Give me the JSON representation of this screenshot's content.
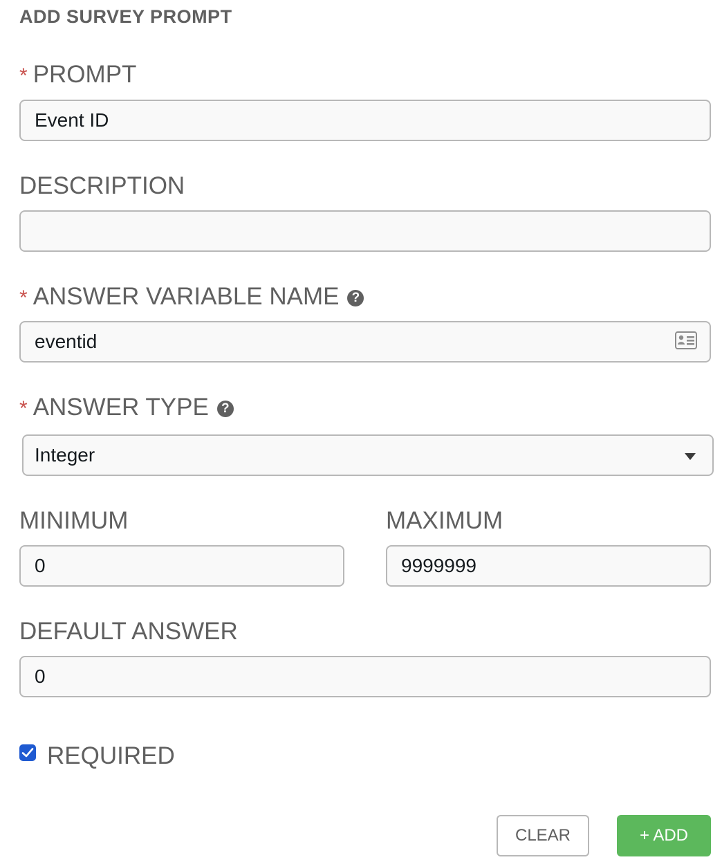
{
  "form": {
    "title": "ADD SURVEY PROMPT"
  },
  "fields": {
    "prompt": {
      "required_mark": "*",
      "label": "PROMPT",
      "value": "Event ID"
    },
    "description": {
      "label": "DESCRIPTION",
      "value": ""
    },
    "answer_variable_name": {
      "required_mark": "*",
      "label": "ANSWER VARIABLE NAME",
      "value": "eventid",
      "help_icon": "question-circle-icon",
      "field_icon": "vcard-icon"
    },
    "answer_type": {
      "required_mark": "*",
      "label": "ANSWER TYPE",
      "selected": "Integer",
      "help_icon": "question-circle-icon",
      "dropdown_icon": "caret-down-icon"
    },
    "minimum": {
      "label": "MINIMUM",
      "value": "0"
    },
    "maximum": {
      "label": "MAXIMUM",
      "value": "9999999"
    },
    "default_answer": {
      "label": "DEFAULT ANSWER",
      "value": "0"
    },
    "required": {
      "label": "REQUIRED",
      "checked": true
    }
  },
  "buttons": {
    "clear_label": "CLEAR",
    "add_label": "+ ADD"
  },
  "colors": {
    "required_star": "#c9534f",
    "checkbox": "#1f5ad1",
    "add_button": "#5cb85c",
    "label_text": "#606060",
    "input_border": "#b8b8b8"
  }
}
